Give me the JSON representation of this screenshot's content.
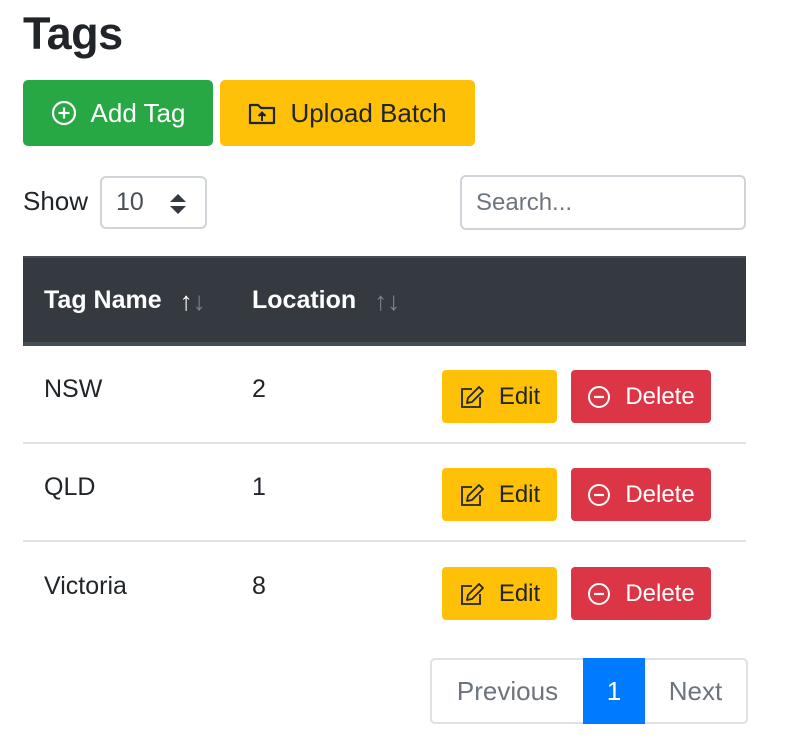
{
  "page": {
    "title": "Tags"
  },
  "toolbar": {
    "add_label": "Add Tag",
    "add_icon": "plus-circle-icon",
    "upload_label": "Upload Batch",
    "upload_icon": "folder-upload-icon"
  },
  "controls": {
    "show_label": "Show",
    "page_size": "10",
    "search_placeholder": "Search...",
    "search_value": ""
  },
  "table": {
    "columns": [
      {
        "label": "Tag Name",
        "sortable": true,
        "sort_state": "ascending"
      },
      {
        "label": "Location",
        "sortable": true,
        "sort_state": "none"
      }
    ],
    "rows": [
      {
        "name": "NSW",
        "location": "2"
      },
      {
        "name": "QLD",
        "location": "1"
      },
      {
        "name": "Victoria",
        "location": "8"
      }
    ],
    "actions": {
      "edit_label": "Edit",
      "edit_icon": "pencil-square-icon",
      "delete_label": "Delete",
      "delete_icon": "dash-circle-icon"
    }
  },
  "pagination": {
    "previous_label": "Previous",
    "current_page": "1",
    "next_label": "Next"
  },
  "colors": {
    "success": "#28a745",
    "warning": "#ffc107",
    "danger": "#dc3545",
    "primary": "#007bff",
    "table_header": "#343a40"
  }
}
